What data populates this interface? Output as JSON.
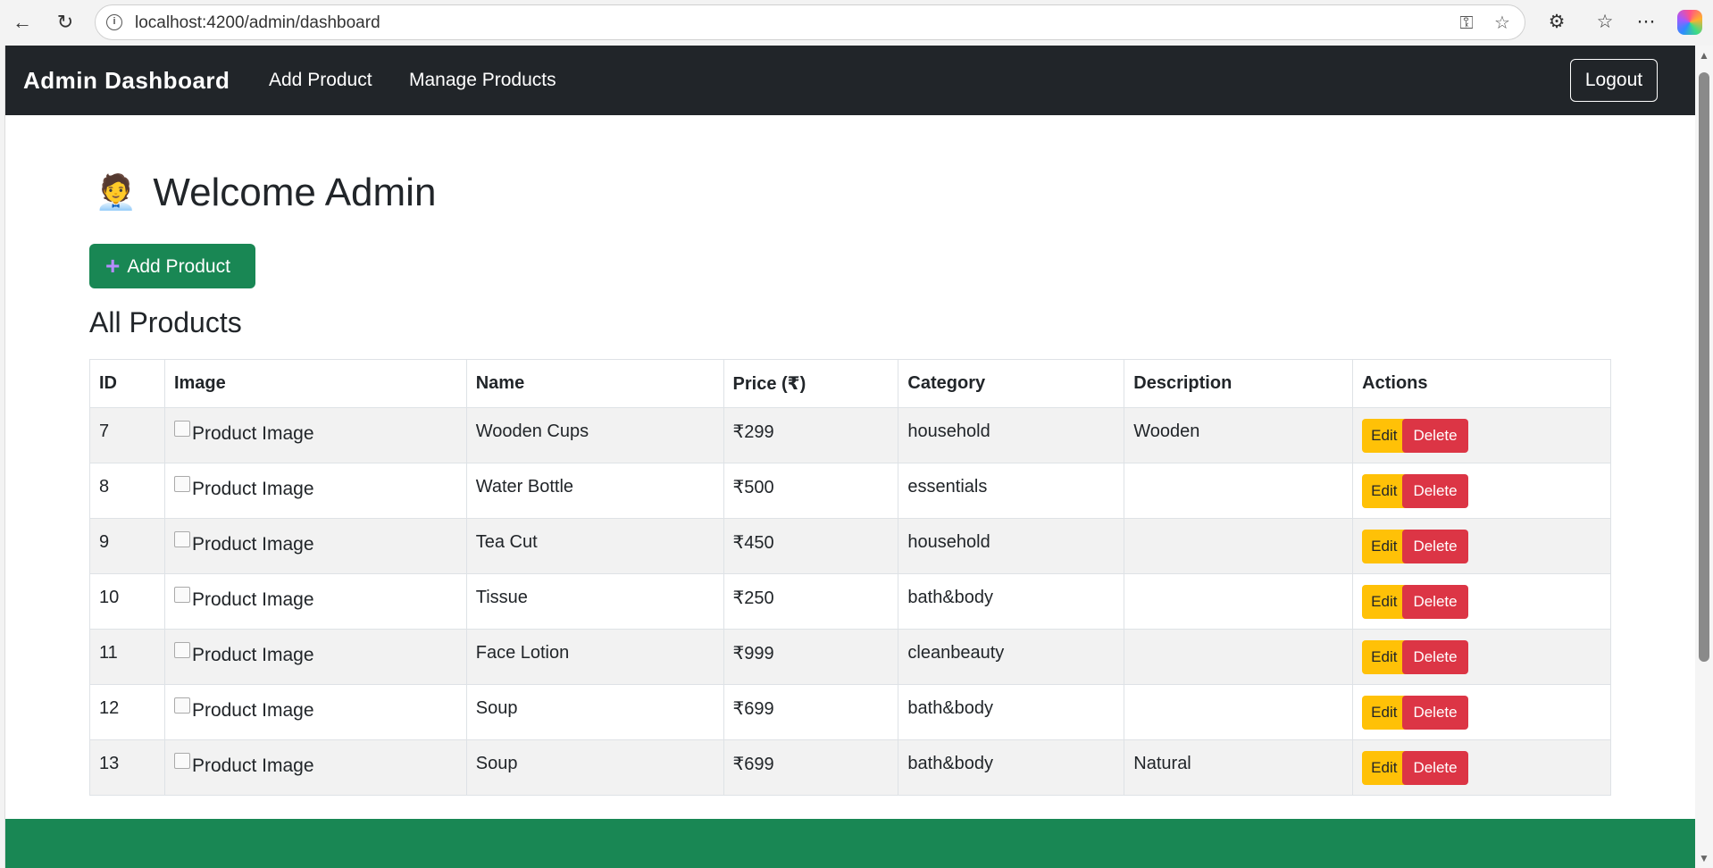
{
  "browser": {
    "url": "localhost:4200/admin/dashboard"
  },
  "navbar": {
    "brand": "Admin Dashboard",
    "links": [
      "Add Product",
      "Manage Products"
    ],
    "logout_label": "Logout"
  },
  "main": {
    "welcome_emoji": "🧑‍💼",
    "welcome_text": "Welcome Admin",
    "add_button_label": "Add Product",
    "section_title": "All Products",
    "columns": [
      "ID",
      "Image",
      "Name",
      "Price (₹)",
      "Category",
      "Description",
      "Actions"
    ],
    "image_alt": "Product Image",
    "edit_label": "Edit",
    "delete_label": "Delete",
    "rows": [
      {
        "id": "7",
        "name": "Wooden Cups",
        "price": "₹299",
        "category": "household",
        "description": "Wooden"
      },
      {
        "id": "8",
        "name": "Water Bottle",
        "price": "₹500",
        "category": "essentials",
        "description": ""
      },
      {
        "id": "9",
        "name": "Tea Cut",
        "price": "₹450",
        "category": "household",
        "description": ""
      },
      {
        "id": "10",
        "name": "Tissue",
        "price": "₹250",
        "category": "bath&body",
        "description": ""
      },
      {
        "id": "11",
        "name": "Face Lotion",
        "price": "₹999",
        "category": "cleanbeauty",
        "description": ""
      },
      {
        "id": "12",
        "name": "Soup",
        "price": "₹699",
        "category": "bath&body",
        "description": ""
      },
      {
        "id": "13",
        "name": "Soup",
        "price": "₹699",
        "category": "bath&body",
        "description": "Natural"
      }
    ]
  },
  "colors": {
    "navbar_bg": "#212529",
    "success": "#198754",
    "warning": "#ffc107",
    "danger": "#dc3545"
  }
}
